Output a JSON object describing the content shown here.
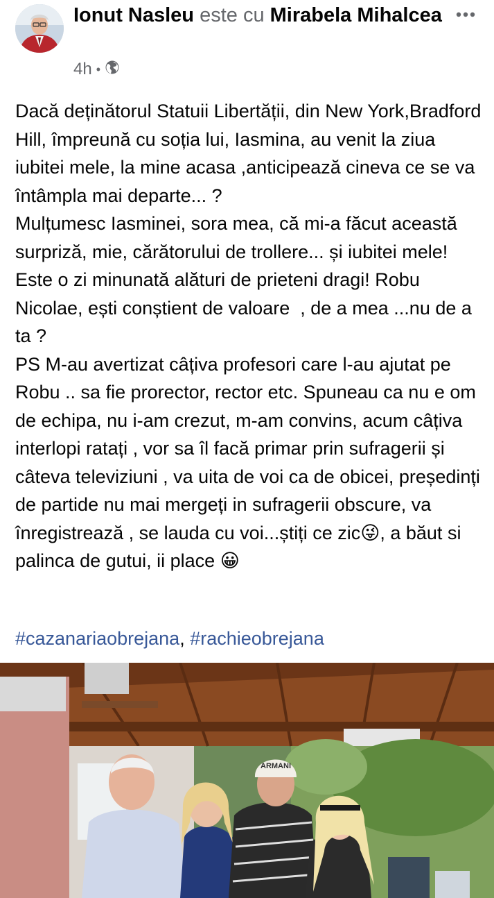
{
  "post": {
    "author": "Ionut Nasleu",
    "with_text": "este cu",
    "tagged": "Mirabela Mihalcea",
    "time": "4h",
    "separator": "•",
    "audience_icon": "globe-icon",
    "more_icon": "more-horizontal-icon",
    "body": "Dacă deținătorul Statuii Libertății, din New York,Bradford Hill, împreună cu soția lui, Iasmina, au venit la ziua iubitei mele, la mine acasa ,anticipează cineva ce se va întâmpla mai departe... ?\nMulțumesc Iasminei, sora mea, că mi-a făcut această surpriză, mie, cărătorului de trollere... și iubitei mele! Este o zi minunată alături de prieteni dragi! Robu Nicolae, ești conștient de valoare  , de a mea ...nu de a ta ?\nPS M-au avertizat câțiva profesori care l-au ajutat pe Robu .. sa fie prorector, rector etc. Spuneau ca nu e om de echipa, nu i-am crezut, m-am convins, acum câțiva interlopi ratați , vor sa îl facă primar prin sufragerii și câteva televiziuni , va uita de voi ca de obicei, președinți de partide nu mai mergeți in sufragerii obscure, va înregistrează , se lauda cu voi...știți ce zic😜, a băut si palinca de gutui, ii place 😀",
    "hashtags": [
      "#cazanariaobrejana",
      "#rachieobrejana"
    ],
    "hashtag_separator": ", ",
    "photo_cap_text": "ARMANI"
  },
  "colors": {
    "text": "#050505",
    "secondary": "#65676b",
    "link": "#385898"
  }
}
